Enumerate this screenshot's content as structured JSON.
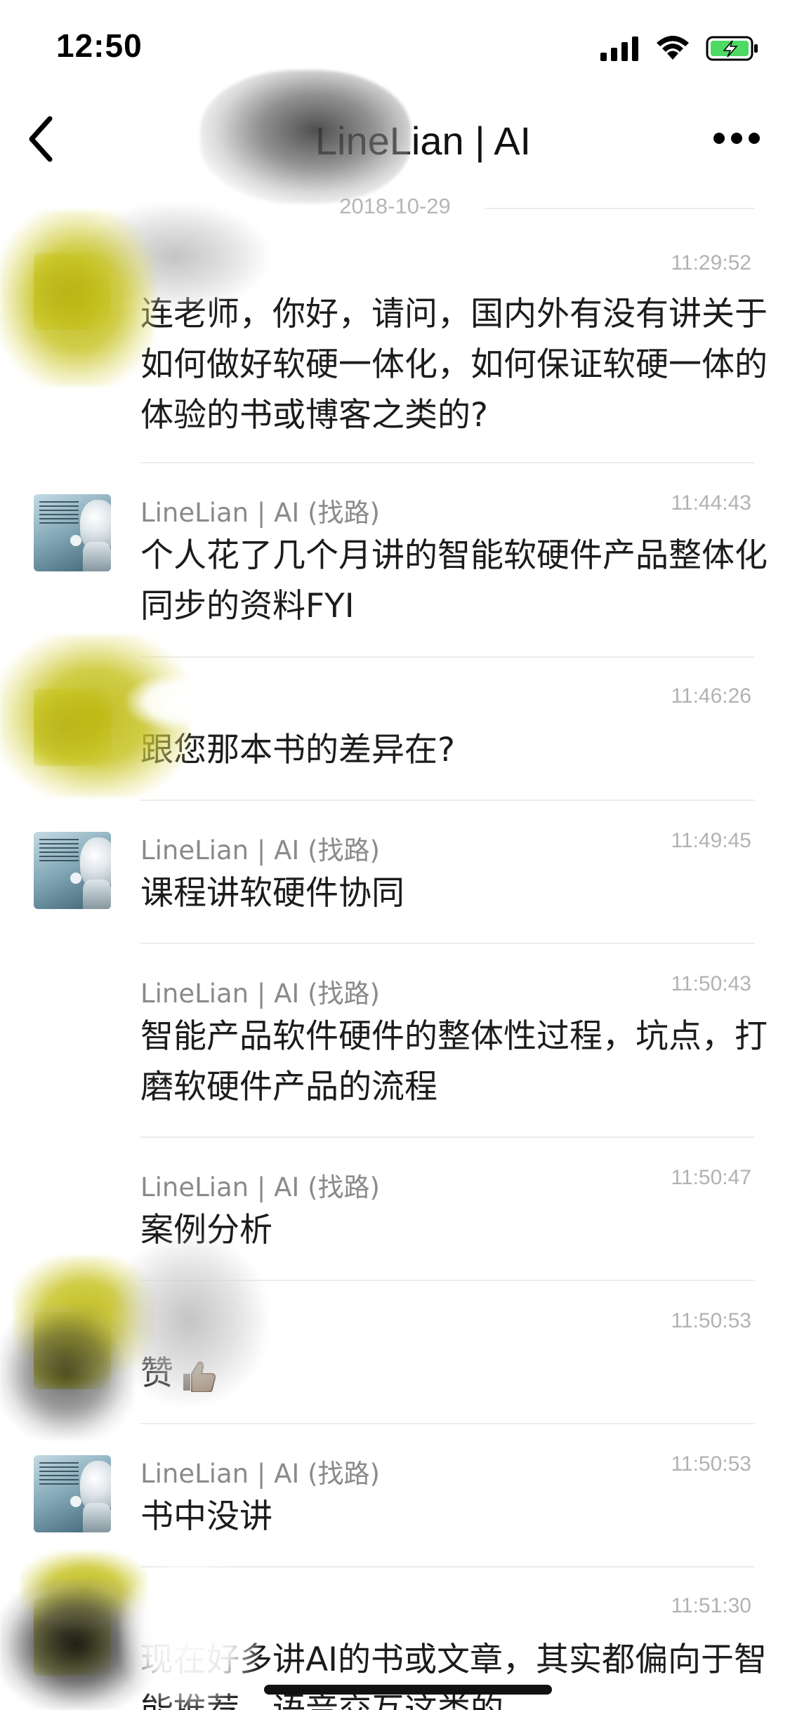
{
  "status_bar": {
    "time": "12:50",
    "icons": [
      "signal-icon",
      "wifi-icon",
      "battery-charging-icon"
    ],
    "battery_color": "#4cd964"
  },
  "nav": {
    "title": "LineLian | AI",
    "back_icon": "chevron-left-icon",
    "more_icon": "more-horizontal-icon"
  },
  "date_separator": "2018-10-29",
  "messages": [
    {
      "sender": "",
      "time": "11:29:52",
      "text": "连老师，你好，请问，国内外有没有讲关于如何做好软硬一体化，如何保证软硬一体的体验的书或博客之类的?",
      "avatar": "redacted"
    },
    {
      "sender": "LineLian | AI (找路)",
      "time": "11:44:43",
      "text": "个人花了几个月讲的智能软硬件产品整体化同步的资料FYI",
      "avatar": "robot"
    },
    {
      "sender": "",
      "time": "11:46:26",
      "text": "跟您那本书的差异在?",
      "avatar": "redacted"
    },
    {
      "sender": "LineLian | AI (找路)",
      "time": "11:49:45",
      "text": "课程讲软硬件协同",
      "avatar": "robot"
    },
    {
      "sender": "LineLian | AI (找路)",
      "time": "11:50:43",
      "text": "智能产品软件硬件的整体性过程，坑点，打磨软硬件产品的流程",
      "avatar": "none"
    },
    {
      "sender": "LineLian | AI (找路)",
      "time": "11:50:47",
      "text": "案例分析",
      "avatar": "none"
    },
    {
      "sender": "",
      "time": "11:50:53",
      "text": "赞",
      "avatar": "redacted",
      "emoji": "thumbs-up-icon"
    },
    {
      "sender": "LineLian | AI (找路)",
      "time": "11:50:53",
      "text": "书中没讲",
      "avatar": "robot"
    },
    {
      "sender": "",
      "time": "11:51:30",
      "text": "现在好多讲AI的书或文章，其实都偏向于智能推荐，语音交互这类的",
      "avatar": "redacted"
    }
  ]
}
